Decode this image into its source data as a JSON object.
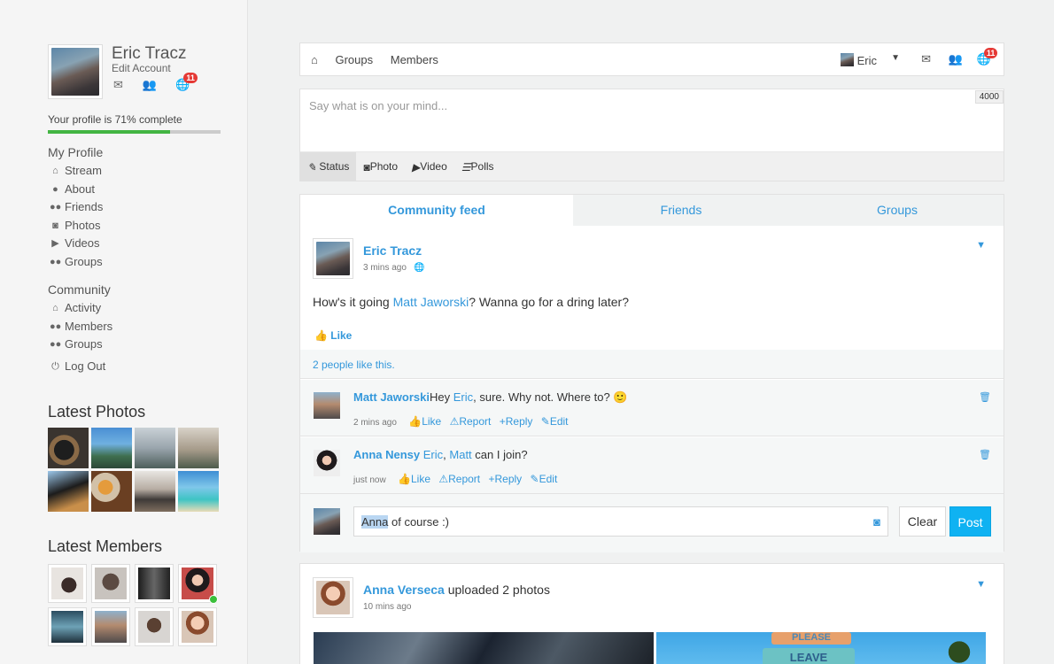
{
  "profile": {
    "name": "Eric Tracz",
    "edit_label": "Edit Account",
    "notif_count": "11",
    "progress_label": "Your profile is 71% complete",
    "progress_pct": 71
  },
  "my_profile": {
    "title": "My Profile",
    "items": [
      {
        "label": "Stream",
        "icon": "home-icon",
        "glyph": "⌂"
      },
      {
        "label": "About",
        "icon": "user-icon",
        "glyph": "👤"
      },
      {
        "label": "Friends",
        "icon": "users-icon",
        "glyph": "👥"
      },
      {
        "label": "Photos",
        "icon": "camera-icon",
        "glyph": "◙"
      },
      {
        "label": "Videos",
        "icon": "video-icon",
        "glyph": "▶"
      },
      {
        "label": "Groups",
        "icon": "groups-icon",
        "glyph": "👥"
      }
    ]
  },
  "community": {
    "title": "Community",
    "items": [
      {
        "label": "Activity",
        "icon": "home-icon",
        "glyph": "⌂"
      },
      {
        "label": "Members",
        "icon": "users-icon",
        "glyph": "👥"
      },
      {
        "label": "Groups",
        "icon": "groups-icon",
        "glyph": "👥"
      }
    ],
    "logout": "Log Out"
  },
  "latest_photos_title": "Latest Photos",
  "latest_members_title": "Latest Members",
  "topnav": {
    "items": [
      "Groups",
      "Members"
    ],
    "user": "Eric",
    "notif_count": "11"
  },
  "composer": {
    "placeholder": "Say what is on your mind...",
    "char_count": "4000",
    "tabs": [
      "Status",
      "Photo",
      "Video",
      "Polls"
    ]
  },
  "feed_tabs": [
    "Community feed",
    "Friends",
    "Groups"
  ],
  "post1": {
    "author": "Eric Tracz",
    "time": "3 mins ago",
    "text_before": "How's it going ",
    "mention": "Matt Jaworski",
    "text_after": "? Wanna go for a dring later?",
    "like_label": "Like",
    "likes_text": "2 people like this."
  },
  "comments": [
    {
      "author": "Matt Jaworski",
      "text_a": "Hey ",
      "mention1": "Eric",
      "text_b": ", sure. Why not. Where to? 🙂",
      "time": "2 mins ago"
    },
    {
      "author": "Anna Nensy",
      "text_a": " ",
      "mention1": "Eric",
      "sep": ", ",
      "mention2": "Matt",
      "text_b": " can I join?",
      "time": "just now"
    }
  ],
  "comment_actions": [
    "Like",
    "Report",
    "Reply",
    "Edit"
  ],
  "reply": {
    "highlight": "Anna",
    "rest": " of course :)",
    "clear": "Clear",
    "post": "Post"
  },
  "post2": {
    "author": "Anna Verseca",
    "action": " uploaded 2 photos",
    "time": "10 mins ago",
    "sign1": "PLEASE",
    "sign2": "LEAVE"
  }
}
